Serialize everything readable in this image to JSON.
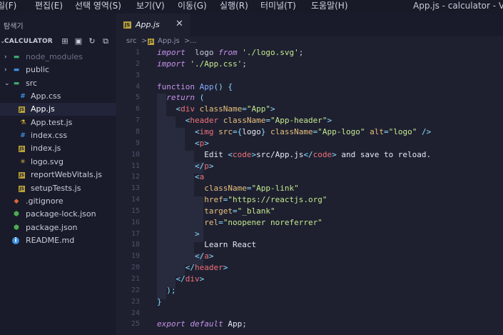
{
  "menubar": {
    "items": [
      "일(F)",
      "편집(E)",
      "선택 영역(S)",
      "보기(V)",
      "이동(G)",
      "실행(R)",
      "터미널(T)",
      "도움말(H)"
    ],
    "window_title": "App.js - calculator - Visu"
  },
  "explorer": {
    "title": "탐색기",
    "project": "CALCULATOR",
    "actions": [
      {
        "name": "new-file-icon",
        "glyph": "⊞"
      },
      {
        "name": "new-folder-icon",
        "glyph": "▣"
      },
      {
        "name": "refresh-icon",
        "glyph": "↻"
      },
      {
        "name": "collapse-all-icon",
        "glyph": "⧉"
      }
    ],
    "tree": [
      {
        "label": "node_modules",
        "type": "folder",
        "expanded": false,
        "depth": 0,
        "color": "#6d7088",
        "icon_color": "#3fa66b"
      },
      {
        "label": "public",
        "type": "folder",
        "expanded": false,
        "depth": 0,
        "color": "#c8cbd8",
        "icon_color": "#3d8fe0"
      },
      {
        "label": "src",
        "type": "folder",
        "expanded": true,
        "depth": 0,
        "color": "#c8cbd8",
        "icon_color": "#3fa66b"
      },
      {
        "label": "App.css",
        "type": "css",
        "depth": 1,
        "color": "#c8cbd8"
      },
      {
        "label": "App.js",
        "type": "js",
        "depth": 1,
        "color": "#ffffff",
        "active": true
      },
      {
        "label": "App.test.js",
        "type": "test",
        "depth": 1,
        "color": "#c8cbd8"
      },
      {
        "label": "index.css",
        "type": "css",
        "depth": 1,
        "color": "#c8cbd8"
      },
      {
        "label": "index.js",
        "type": "js",
        "depth": 1,
        "color": "#c8cbd8"
      },
      {
        "label": "logo.svg",
        "type": "svg",
        "depth": 1,
        "color": "#c8cbd8"
      },
      {
        "label": "reportWebVitals.js",
        "type": "js",
        "depth": 1,
        "color": "#c8cbd8"
      },
      {
        "label": "setupTests.js",
        "type": "js",
        "depth": 1,
        "color": "#c8cbd8"
      },
      {
        "label": ".gitignore",
        "type": "git",
        "depth": 0,
        "color": "#c8cbd8"
      },
      {
        "label": "package-lock.json",
        "type": "json",
        "depth": 0,
        "color": "#c8cbd8"
      },
      {
        "label": "package.json",
        "type": "json",
        "depth": 0,
        "color": "#c8cbd8"
      },
      {
        "label": "README.md",
        "type": "info",
        "depth": 0,
        "color": "#c8cbd8"
      }
    ]
  },
  "editor": {
    "tab": {
      "label": "App.js",
      "icon": "JS",
      "close": "✕"
    },
    "breadcrumb": [
      "src",
      ">",
      "JS",
      "App.js",
      ">",
      "..."
    ],
    "line_numbers": [
      "1",
      "2",
      "3",
      "4",
      "5",
      "6",
      "7",
      "8",
      "9",
      "10",
      "11",
      "12",
      "13",
      "14",
      "15",
      "16",
      "17",
      "18",
      "19",
      "20",
      "21",
      "22",
      "23",
      "24",
      "25"
    ],
    "lines": [
      [
        [
          "k",
          "import"
        ],
        [
          "",
          "  logo "
        ],
        [
          "k",
          "from"
        ],
        [
          "s",
          " './logo.svg'"
        ],
        [
          "",
          ";"
        ]
      ],
      [
        [
          "k",
          "import"
        ],
        [
          "s",
          " './App.css'"
        ],
        [
          "",
          ";"
        ]
      ],
      [],
      [
        [
          "kw",
          "function"
        ],
        [
          "f",
          " App"
        ],
        [
          "p",
          "()"
        ],
        [
          "p",
          " {"
        ]
      ],
      [
        [
          "",
          "  "
        ],
        [
          "k",
          "return"
        ],
        [
          "p",
          " ("
        ]
      ],
      [
        [
          "",
          "    "
        ],
        [
          "p",
          "<"
        ],
        [
          "t",
          "div"
        ],
        [
          "a",
          " className"
        ],
        [
          "p",
          "="
        ],
        [
          "s",
          "\"App\""
        ],
        [
          "p",
          ">"
        ]
      ],
      [
        [
          "",
          "      "
        ],
        [
          "p",
          "<"
        ],
        [
          "t",
          "header"
        ],
        [
          "a",
          " className"
        ],
        [
          "p",
          "="
        ],
        [
          "s",
          "\"App-header\""
        ],
        [
          "p",
          ">"
        ]
      ],
      [
        [
          "",
          "        "
        ],
        [
          "p",
          "<"
        ],
        [
          "t",
          "img"
        ],
        [
          "a",
          " src"
        ],
        [
          "p",
          "={"
        ],
        [
          "v",
          "logo"
        ],
        [
          "p",
          "}"
        ],
        [
          "a",
          " className"
        ],
        [
          "p",
          "="
        ],
        [
          "s",
          "\"App-logo\""
        ],
        [
          "a",
          " alt"
        ],
        [
          "p",
          "="
        ],
        [
          "s",
          "\"logo\""
        ],
        [
          "p",
          " />"
        ]
      ],
      [
        [
          "",
          "        "
        ],
        [
          "p",
          "<"
        ],
        [
          "t",
          "p"
        ],
        [
          "p",
          ">"
        ]
      ],
      [
        [
          "",
          "          "
        ],
        [
          "v",
          "Edit "
        ],
        [
          "p",
          "<"
        ],
        [
          "t",
          "code"
        ],
        [
          "p",
          ">"
        ],
        [
          "v",
          "src/App.js"
        ],
        [
          "p",
          "</"
        ],
        [
          "t",
          "code"
        ],
        [
          "p",
          ">"
        ],
        [
          "v",
          " and save to reload."
        ]
      ],
      [
        [
          "",
          "        "
        ],
        [
          "p",
          "</"
        ],
        [
          "t",
          "p"
        ],
        [
          "p",
          ">"
        ]
      ],
      [
        [
          "",
          "        "
        ],
        [
          "p",
          "<"
        ],
        [
          "t",
          "a"
        ]
      ],
      [
        [
          "",
          "          "
        ],
        [
          "a",
          "className"
        ],
        [
          "p",
          "="
        ],
        [
          "s",
          "\"App-link\""
        ]
      ],
      [
        [
          "",
          "          "
        ],
        [
          "a",
          "href"
        ],
        [
          "p",
          "="
        ],
        [
          "s",
          "\"https://reactjs.org\""
        ]
      ],
      [
        [
          "",
          "          "
        ],
        [
          "a",
          "target"
        ],
        [
          "p",
          "="
        ],
        [
          "s",
          "\"_blank\""
        ]
      ],
      [
        [
          "",
          "          "
        ],
        [
          "a",
          "rel"
        ],
        [
          "p",
          "="
        ],
        [
          "s",
          "\"noopener noreferrer\""
        ]
      ],
      [
        [
          "",
          "        "
        ],
        [
          "p",
          ">"
        ]
      ],
      [
        [
          "",
          "          "
        ],
        [
          "v",
          "Learn React"
        ]
      ],
      [
        [
          "",
          "        "
        ],
        [
          "p",
          "</"
        ],
        [
          "t",
          "a"
        ],
        [
          "p",
          ">"
        ]
      ],
      [
        [
          "",
          "      "
        ],
        [
          "p",
          "</"
        ],
        [
          "t",
          "header"
        ],
        [
          "p",
          ">"
        ]
      ],
      [
        [
          "",
          "    "
        ],
        [
          "p",
          "</"
        ],
        [
          "t",
          "div"
        ],
        [
          "p",
          ">"
        ]
      ],
      [
        [
          "",
          "  "
        ],
        [
          "p",
          ");"
        ]
      ],
      [
        [
          "p",
          "}"
        ]
      ],
      [],
      [
        [
          "k",
          "export"
        ],
        [
          "k",
          " default"
        ],
        [
          "v",
          " App"
        ],
        [
          "",
          ";"
        ]
      ]
    ]
  }
}
